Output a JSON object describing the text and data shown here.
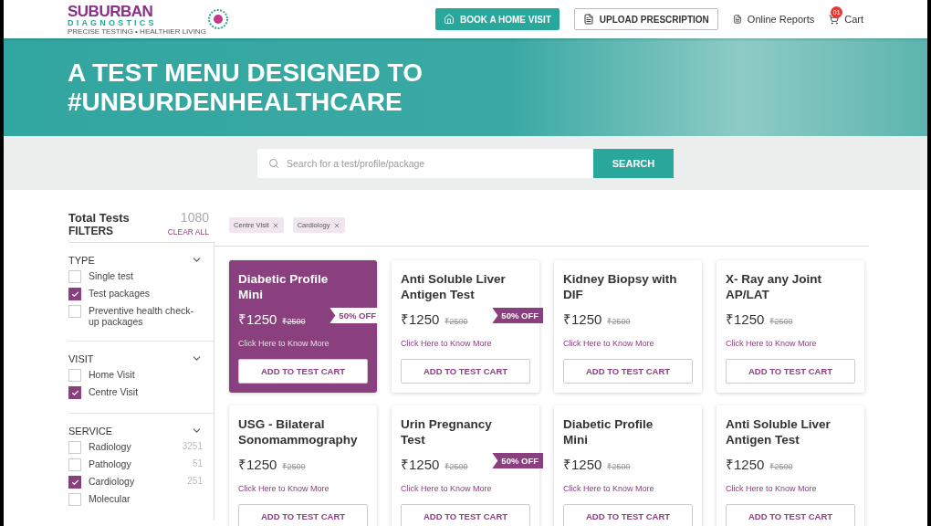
{
  "header": {
    "logo": {
      "name": "SUBURBAN",
      "sub": "DIAGNOSTICS",
      "tagline": "PRECISE TESTING • HEALTHIER LIVING"
    },
    "actions": [
      {
        "kind": "primary",
        "label": "BOOK A HOME VISIT"
      },
      {
        "kind": "outline",
        "label": "UPLOAD PRESCRIPTION"
      },
      {
        "kind": "link",
        "label": "Online Reports"
      },
      {
        "kind": "cart",
        "label": "Cart",
        "badge": "01"
      }
    ]
  },
  "hero": {
    "title_lines": [
      "A TEST MENU DESIGNED TO",
      "#UNBURDENHEALTHCARE"
    ]
  },
  "search": {
    "placeholder": "Search for a test/profile/package",
    "button": "SEARCH"
  },
  "sidebar": {
    "total_label": "Total Tests",
    "total": "1080",
    "filters_label": "FILTERS",
    "clear": "CLEAR ALL",
    "groups": [
      {
        "title": "TYPE",
        "expanded": true,
        "items": [
          {
            "label": "Single test",
            "checked": false
          },
          {
            "label": "Test packages",
            "checked": true
          },
          {
            "label": "Preventive health check-up packages",
            "checked": false
          }
        ]
      },
      {
        "title": "VISIT",
        "expanded": true,
        "items": [
          {
            "label": "Home Visit",
            "checked": false
          },
          {
            "label": "Centre Visit",
            "checked": true
          }
        ]
      },
      {
        "title": "SERVICE",
        "expanded": true,
        "items": [
          {
            "label": "Radiology",
            "checked": false,
            "count": "3251"
          },
          {
            "label": "Pathology",
            "checked": false,
            "count": "51"
          },
          {
            "label": "Cardiology",
            "checked": true,
            "count": "251"
          },
          {
            "label": "Molecular",
            "checked": false
          }
        ]
      }
    ]
  },
  "chips": [
    "Centre Visit",
    "Cardiology"
  ],
  "cards": [
    {
      "title": "Diabetic Profile Mini",
      "price": "₹1250",
      "old_price": "₹2500",
      "discount": "50% OFF",
      "link": "Click Here to Know More",
      "button": "ADD TO TEST CART",
      "selected": true
    },
    {
      "title": "Anti Soluble Liver Antigen Test",
      "price": "₹1250",
      "old_price": "₹2500",
      "discount": "50% OFF",
      "link": "Click Here to Know More",
      "button": "ADD TO TEST CART",
      "selected": false
    },
    {
      "title": "Kidney Biopsy with DIF",
      "price": "₹1250",
      "old_price": "₹2500",
      "link": "Click Here to Know More",
      "button": "ADD TO TEST CART",
      "selected": false
    },
    {
      "title": "X- Ray any Joint AP/LAT",
      "price": "₹1250",
      "old_price": "₹2500",
      "link": "Click Here to Know More",
      "button": "ADD TO TEST CART",
      "selected": false
    },
    {
      "title": "USG - Bilateral Sonomammography",
      "price": "₹1250",
      "old_price": "₹2500",
      "link": "Click Here to Know More",
      "button": "ADD TO TEST CART",
      "selected": false
    },
    {
      "title": "Urin Pregnancy Test",
      "price": "₹1250",
      "old_price": "₹2500",
      "discount": "50% OFF",
      "link": "Click Here to Know More",
      "button": "ADD TO TEST CART",
      "selected": false
    },
    {
      "title": "Diabetic Profile Mini",
      "price": "₹1250",
      "old_price": "₹2500",
      "link": "Click Here to Know More",
      "button": "ADD TO TEST CART",
      "selected": false
    },
    {
      "title": "Anti Soluble Liver Antigen Test",
      "price": "₹1250",
      "old_price": "₹2500",
      "link": "Click Here to Know More",
      "button": "ADD TO TEST CART",
      "selected": false
    }
  ]
}
